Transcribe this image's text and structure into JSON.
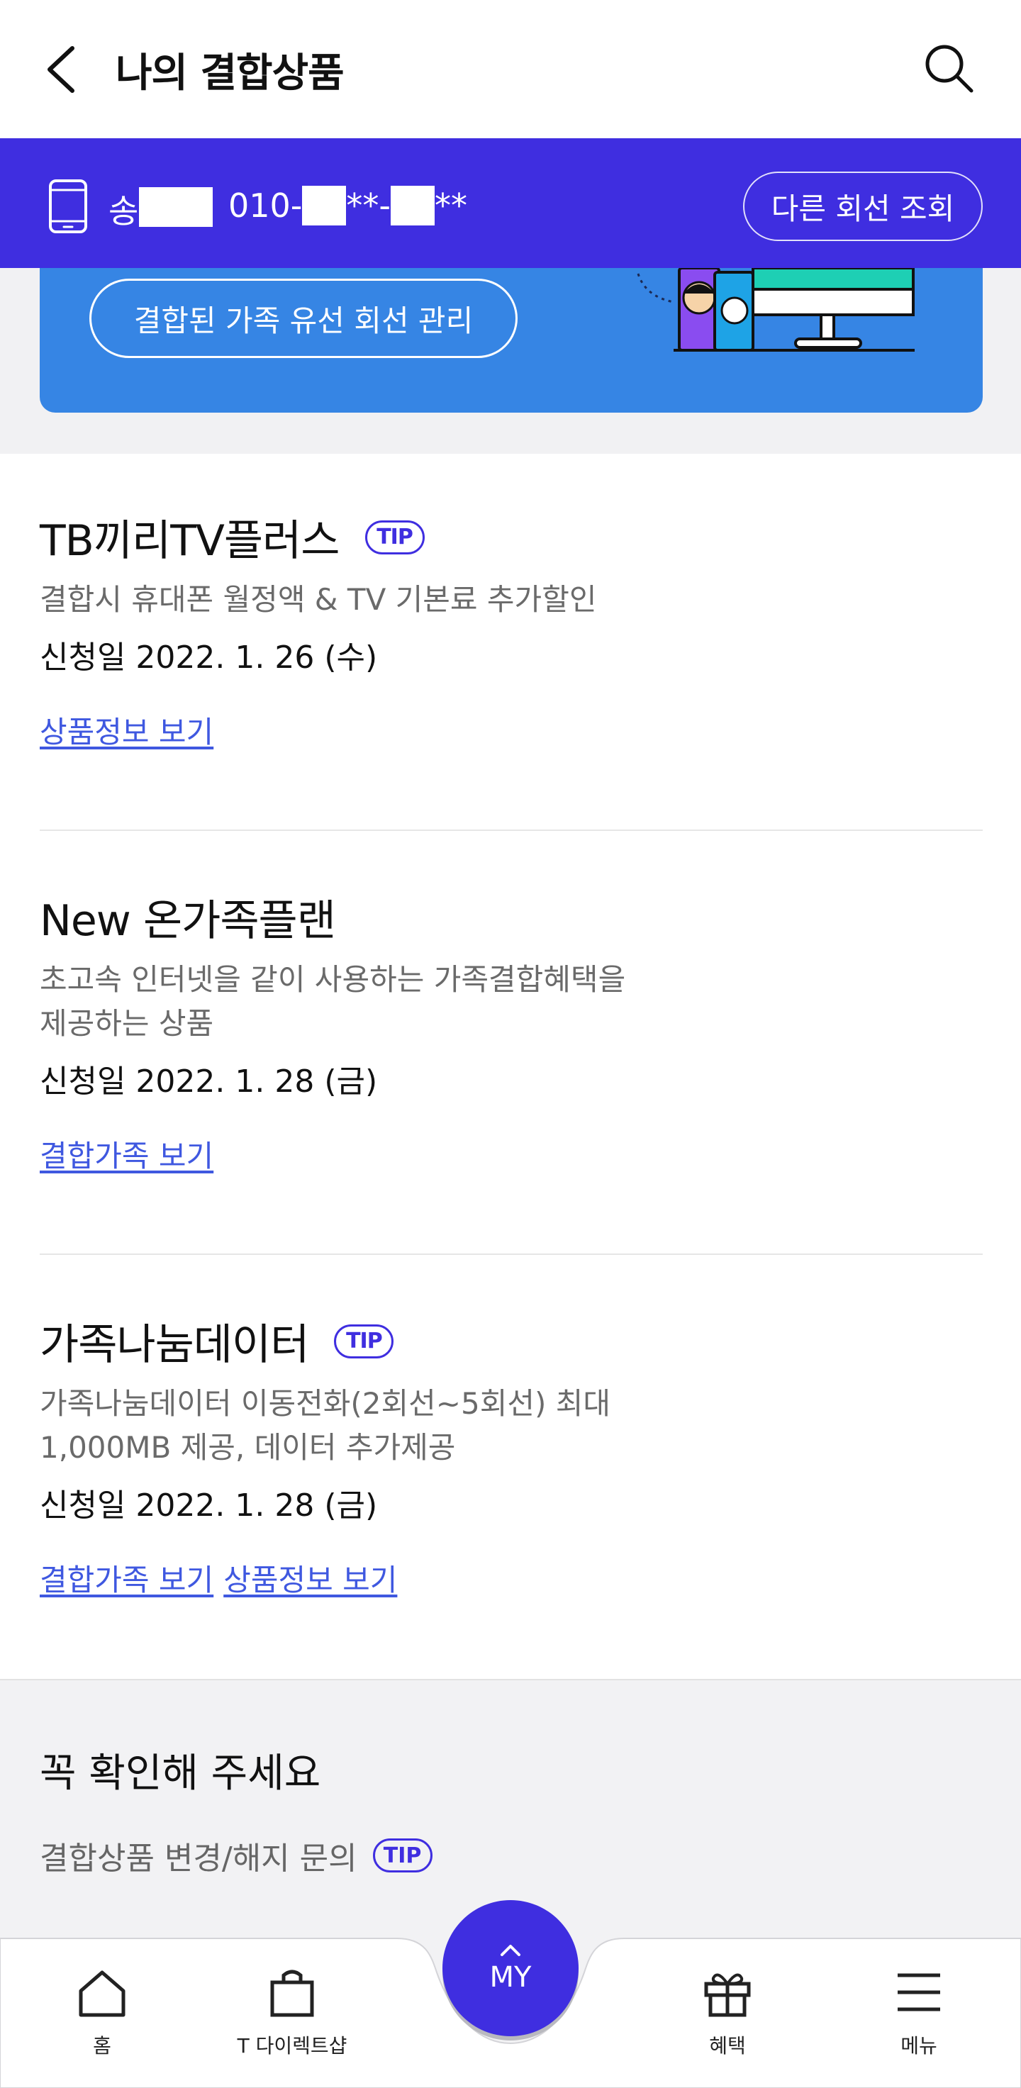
{
  "header": {
    "title": "나의 결합상품",
    "back_icon": "chevron-left-icon",
    "search_icon": "search-icon"
  },
  "line_bar": {
    "name_prefix": "송",
    "number_parts": [
      "010-",
      "**-",
      "**"
    ],
    "other_line_label": "다른 회선 조회",
    "icon": "phone-icon",
    "bg_color": "#3f2ee0"
  },
  "banner": {
    "wired_manage_label": "결합된 가족 유선 회선 관리",
    "bg_color": "#3685e4"
  },
  "products": [
    {
      "title": "TB끼리TV플러스",
      "has_tip": true,
      "tip_label": "TIP",
      "desc": [
        "결합시 휴대폰 월정액 & TV 기본료 추가할인"
      ],
      "date": "신청일 2022. 1. 26 (수)",
      "links": [
        "상품정보 보기"
      ]
    },
    {
      "title": "New 온가족플랜",
      "has_tip": false,
      "desc": [
        "초고속 인터넷을 같이 사용하는 가족결합혜택을",
        "제공하는 상품"
      ],
      "date": "신청일 2022. 1. 28 (금)",
      "links": [
        "결합가족 보기"
      ]
    },
    {
      "title": "가족나눔데이터",
      "has_tip": true,
      "tip_label": "TIP",
      "desc": [
        "가족나눔데이터 이동전화(2회선~5회선) 최대",
        "1,000MB 제공, 데이터 추가제공"
      ],
      "date": "신청일 2022. 1. 28 (금)",
      "links": [
        "결합가족 보기",
        "상품정보 보기"
      ]
    }
  ],
  "notice": {
    "title": "꼭 확인해 주세요",
    "item_label": "결합상품 변경/해지 문의",
    "tip_label": "TIP"
  },
  "bottom_nav": {
    "items": [
      {
        "label": "홈",
        "icon": "home-icon"
      },
      {
        "label": "T 다이렉트샵",
        "icon": "shopping-bag-icon"
      },
      {
        "label": "혜택",
        "icon": "gift-icon"
      },
      {
        "label": "메뉴",
        "icon": "menu-icon"
      }
    ],
    "my_label": "MY",
    "my_icon": "chevron-up-icon"
  },
  "colors": {
    "brand": "#3f2ee0",
    "link": "#3f58e0",
    "banner": "#3685e4"
  }
}
